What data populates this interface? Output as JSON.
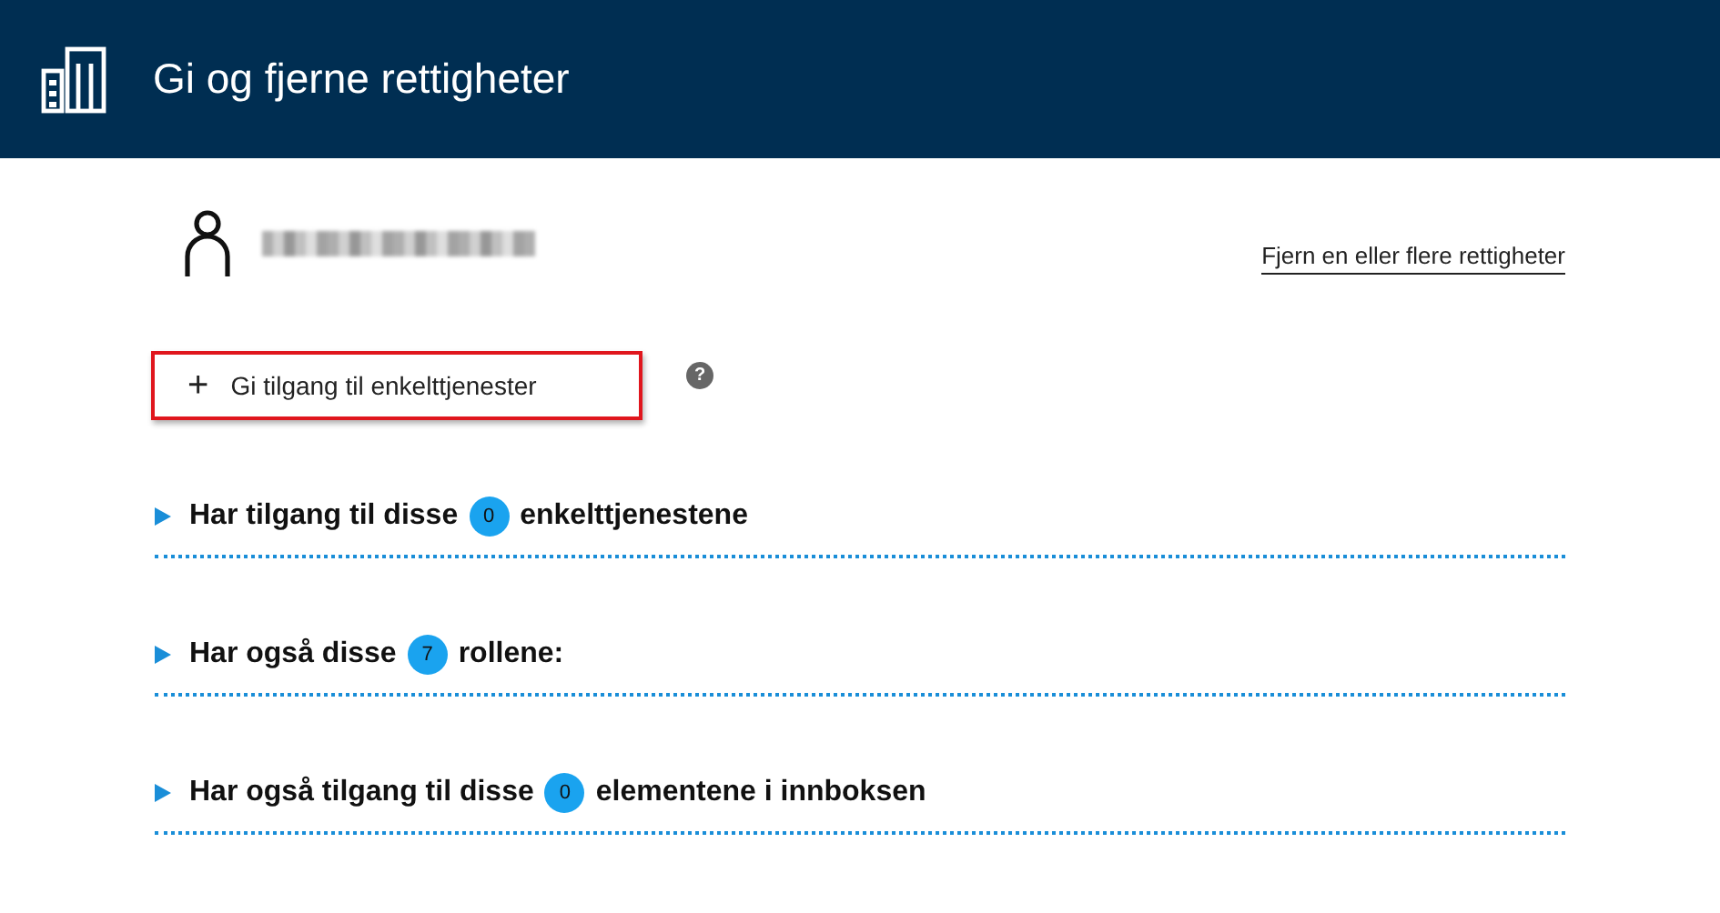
{
  "header": {
    "title": "Gi og fjerne rettigheter"
  },
  "remove_link": "Fjern en eller flere rettigheter",
  "add_button": {
    "icon": "+",
    "label": "Gi tilgang til enkelttjenester",
    "focused": true
  },
  "help_icon": "?",
  "sections": [
    {
      "before": "Har tilgang til disse",
      "count": "0",
      "after": "enkelttjenestene",
      "expanded": false
    },
    {
      "before": "Har også disse",
      "count": "7",
      "after": "rollene:",
      "expanded": false
    },
    {
      "before": "Har også tilgang til disse",
      "count": "0",
      "after": "elementene i innboksen",
      "expanded": false
    }
  ]
}
